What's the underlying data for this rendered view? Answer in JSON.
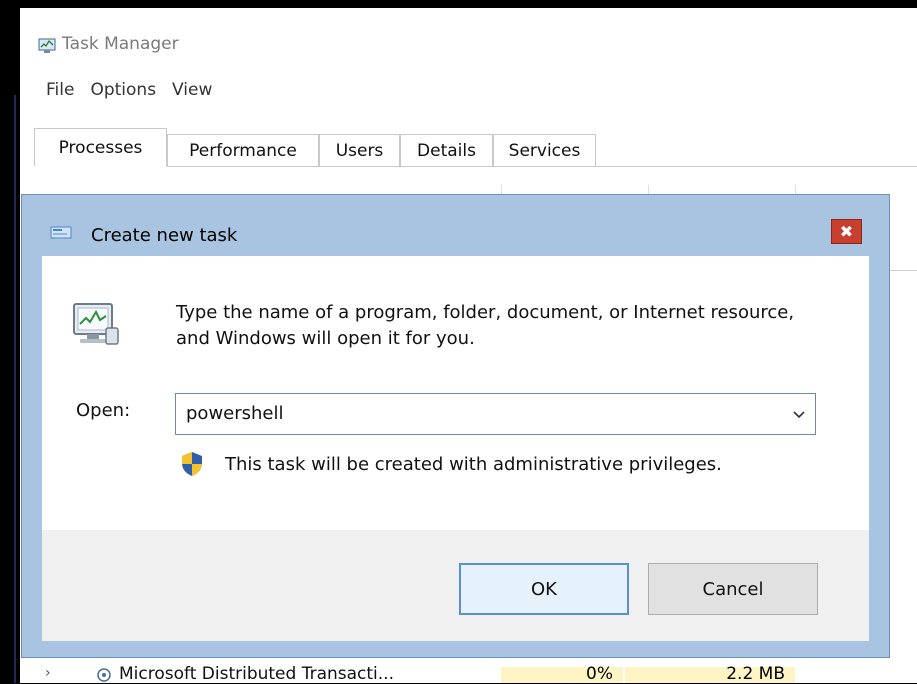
{
  "task_manager": {
    "title": "Task Manager",
    "menu": [
      "File",
      "Options",
      "View"
    ],
    "tabs": [
      {
        "label": "Processes",
        "active": true
      },
      {
        "label": "Performance",
        "active": false
      },
      {
        "label": "Users",
        "active": false
      },
      {
        "label": "Details",
        "active": false
      },
      {
        "label": "Services",
        "active": false
      }
    ],
    "background_row": {
      "name": "Microsoft Distributed Transacti...",
      "cpu": "0%",
      "memory": "2.2 MB"
    }
  },
  "dialog": {
    "title": "Create new task",
    "message": "Type the name of a program, folder, document, or Internet resource, and Windows will open it for you.",
    "open_label": "Open:",
    "open_value": "powershell",
    "admin_note": "This task will be created with administrative privileges.",
    "ok_label": "OK",
    "cancel_label": "Cancel",
    "close_glyph": "✖"
  },
  "colors": {
    "dialog_frame": "#a8c4e0",
    "close_button": "#c7402f",
    "highlight_cell": "#fff4c4",
    "default_button_border": "#5b8fd0"
  },
  "icons": [
    "task-manager-icon",
    "run-dialog-icon",
    "program-monitor-icon",
    "uac-shield-icon",
    "dropdown-chevron-icon",
    "close-icon",
    "expand-chevron-icon",
    "service-icon"
  ]
}
